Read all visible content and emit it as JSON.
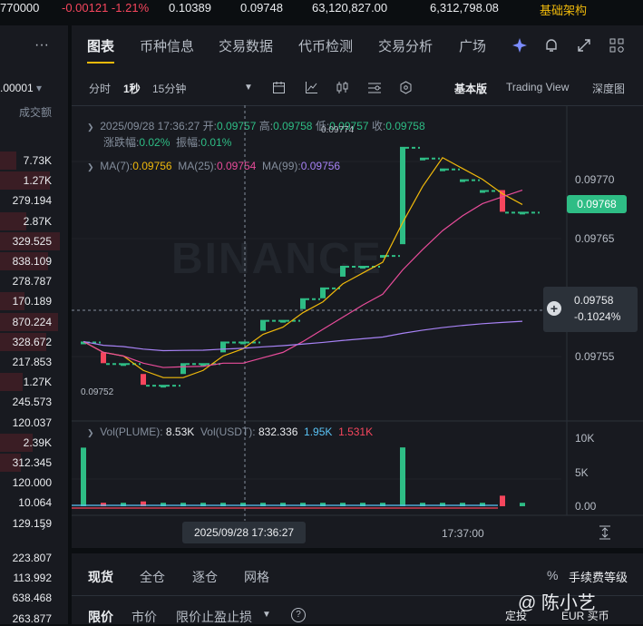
{
  "topbar": {
    "price_cut": "770000",
    "change": "-0.00121 -1.21%",
    "high": "0.10389",
    "low": "0.09748",
    "vol_plume": "63,120,827.00",
    "vol_usdt": "6,312,798.08",
    "infra_label": "基础架构"
  },
  "left": {
    "menu_icon": "more-icon",
    "precision": ".00001",
    "header": "成交额",
    "rows": [
      "7.73K",
      "1.27K",
      "279.194",
      "2.87K",
      "329.525",
      "838.109",
      "278.787",
      "170.189",
      "870.224",
      "328.672",
      "217.853",
      "1.27K",
      "245.573",
      "120.037",
      "2.39K",
      "312.345",
      "120.000",
      "10.064",
      "129.159"
    ],
    "bottom_rows": [
      "223.807",
      "113.992",
      "638.468",
      "263.877"
    ]
  },
  "tabs": [
    "图表",
    "币种信息",
    "交易数据",
    "代币检测",
    "交易分析",
    "广场"
  ],
  "toolbar": {
    "intervals": [
      "分时",
      "1秒",
      "15分钟"
    ],
    "modes": [
      "基本版",
      "Trading View",
      "深度图"
    ]
  },
  "ohlc": {
    "datetime": "2025/09/28 17:36:27",
    "open_label": "开:",
    "open": "0.09757",
    "high_label": "高:",
    "high": "0.09758",
    "low_label": "低:",
    "low": "0.09757",
    "close_label": "收:",
    "close": "0.09758",
    "change_label": "涨跌幅:",
    "change": "0.02%",
    "amp_label": "振幅:",
    "amp": "0.01%"
  },
  "ma": {
    "ma7_label": "MA(7):",
    "ma7": "0.09756",
    "ma25_label": "MA(25):",
    "ma25": "0.09754",
    "ma99_label": "MA(99):",
    "ma99": "0.09756"
  },
  "price_axis": {
    "labels": [
      "0.09770",
      "0.09765",
      "0.09755"
    ],
    "current": "0.09768",
    "cross_price": "0.09758",
    "cross_pct": "-0.1024%",
    "max_marker": "0.09774",
    "min_marker": "0.09752"
  },
  "volume": {
    "vol_plume_label": "Vol(PLUME):",
    "vol_plume": "8.53K",
    "vol_usdt_label": "Vol(USDT):",
    "vol_usdt": "832.336",
    "v1": "1.95K",
    "v2": "1.531K",
    "axis": [
      "10K",
      "5K",
      "0.00"
    ]
  },
  "time_axis": {
    "cross_time": "2025/09/28 17:36:27",
    "tick": "17:37:00"
  },
  "watermark": "BINANCE",
  "colors": {
    "up": "#2ebd85",
    "down": "#f6465d",
    "ma7": "#f0b90b",
    "ma25": "#e84c9a",
    "ma99": "#a782f5",
    "accent": "#f0b90b"
  },
  "bottom": {
    "tabs": [
      "现货",
      "全仓",
      "逐仓",
      "网格"
    ],
    "fee_label": "手续费等级",
    "order_types": [
      "限价",
      "市价",
      "限价止盈止损"
    ],
    "overlay_name": "@ 陈小艺",
    "overlay_fixed": "定投",
    "overlay_buy": "EUR 买币"
  },
  "chart_data": {
    "type": "candlestick",
    "price_range": [
      0.0975,
      0.09776
    ],
    "candles": [
      {
        "open": 0.09756,
        "close": 0.09756
      },
      {
        "open": 0.09755,
        "close": 0.09754
      },
      {
        "open": 0.09754,
        "close": 0.09754
      },
      {
        "open": 0.09753,
        "close": 0.09752
      },
      {
        "open": 0.09752,
        "close": 0.09752
      },
      {
        "open": 0.09753,
        "close": 0.09754
      },
      {
        "open": 0.09754,
        "close": 0.09754
      },
      {
        "open": 0.09755,
        "close": 0.09756
      },
      {
        "open": 0.09756,
        "close": 0.09756
      },
      {
        "open": 0.09757,
        "close": 0.09758
      },
      {
        "open": 0.09758,
        "close": 0.09758
      },
      {
        "open": 0.09759,
        "close": 0.0976
      },
      {
        "open": 0.0976,
        "close": 0.09761
      },
      {
        "open": 0.09762,
        "close": 0.09763
      },
      {
        "open": 0.09763,
        "close": 0.09763
      },
      {
        "open": 0.09764,
        "close": 0.09764
      },
      {
        "open": 0.09765,
        "close": 0.09774
      },
      {
        "open": 0.09773,
        "close": 0.09773
      },
      {
        "open": 0.09772,
        "close": 0.09772
      },
      {
        "open": 0.09771,
        "close": 0.09771
      },
      {
        "open": 0.0977,
        "close": 0.0977
      },
      {
        "open": 0.0977,
        "close": 0.09768
      },
      {
        "open": 0.09768,
        "close": 0.09768
      }
    ],
    "volumes": [
      8500,
      500,
      500,
      700,
      500,
      500,
      500,
      500,
      500,
      500,
      500,
      500,
      500,
      500,
      500,
      500,
      8530,
      500,
      500,
      500,
      500,
      1531,
      500
    ]
  }
}
